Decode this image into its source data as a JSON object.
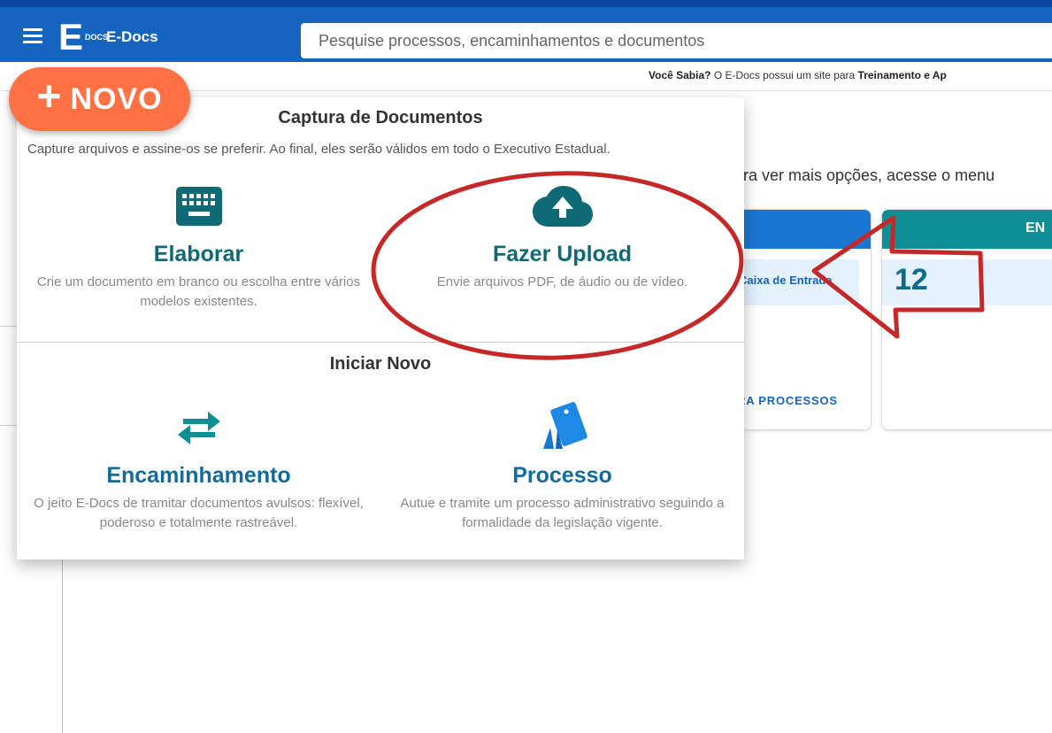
{
  "app": {
    "name": "E-Docs",
    "logo_letter": "E",
    "logo_sub": "DOCS",
    "brand_color": "#1565c0"
  },
  "search": {
    "placeholder": "Pesquise processos, encaminhamentos e documentos"
  },
  "tip": {
    "label": "Você Sabia?",
    "text": " O E-Docs possui um site para ",
    "bold_tail": "Treinamento e Ap"
  },
  "background": {
    "hint": "ra ver mais opções, acesse o menu",
    "card1_link": "Caixa de Entrada",
    "card1_footer": "RA PROCESSOS",
    "card2_head": "EN",
    "card2_count": "12"
  },
  "novo_button": {
    "plus": "+",
    "label": "NOVO",
    "color": "#ff7043"
  },
  "panel": {
    "capture_title": "Captura de Documentos",
    "capture_desc": "Capture arquivos e assine-os se preferir. Ao final, eles serão válidos em todo o Executivo Estadual.",
    "options_capture": [
      {
        "icon": "keyboard-icon",
        "title": "Elaborar",
        "desc": "Crie um documento em branco ou escolha entre vários modelos existentes."
      },
      {
        "icon": "cloud-upload-icon",
        "title": "Fazer Upload",
        "desc": "Envie arquivos PDF, de áudio ou de vídeo."
      }
    ],
    "start_title": "Iniciar Novo",
    "options_start": [
      {
        "icon": "swap-arrows-icon",
        "title": "Encaminhamento",
        "desc": "O jeito E-Docs de tramitar documentos avulsos: flexível, poderoso e totalmente rastreável."
      },
      {
        "icon": "process-folder-icon",
        "title": "Processo",
        "desc": "Autue e tramite um processo administrativo seguindo a formalidade da legislação vigente."
      }
    ]
  },
  "annotation_color": "#c62828"
}
